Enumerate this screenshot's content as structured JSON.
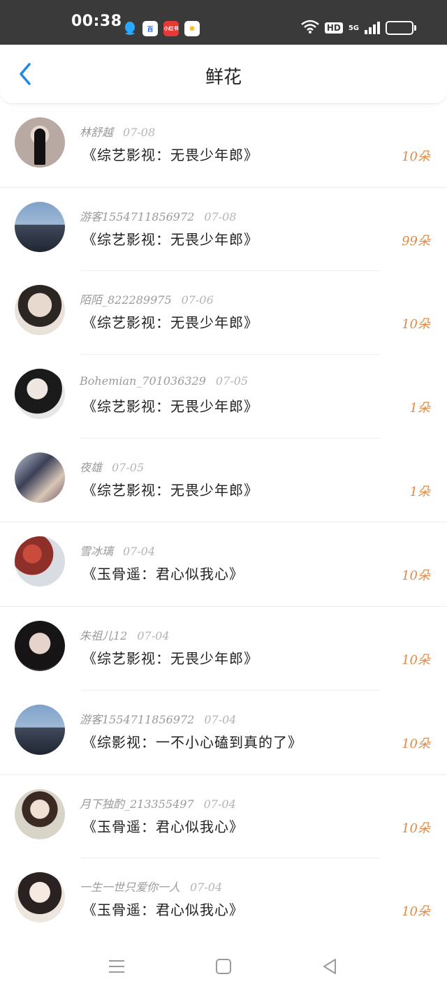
{
  "status_bar": {
    "time": "00:38",
    "apps": [
      {
        "name": "qq-app-icon"
      },
      {
        "name": "baidu-app-icon",
        "label": "百"
      },
      {
        "name": "xiaohongshu-app-icon",
        "label": "小红书"
      },
      {
        "name": "wechat-app-icon",
        "label": "●"
      }
    ],
    "hd_label": "HD",
    "network_label": "5G"
  },
  "header": {
    "title": "鲜花"
  },
  "items": [
    {
      "username": "林舒越",
      "date": "07-08",
      "work": "《综艺影视：无畏少年郎》",
      "count": "10朵"
    },
    {
      "username": "游客1554711856972",
      "date": "07-08",
      "work": "《综艺影视：无畏少年郎》",
      "count": "99朵"
    },
    {
      "username": "陌陌_822289975",
      "date": "07-06",
      "work": "《综艺影视：无畏少年郎》",
      "count": "10朵"
    },
    {
      "username": "Bohemian_701036329",
      "date": "07-05",
      "work": "《综艺影视：无畏少年郎》",
      "count": "1朵"
    },
    {
      "username": "夜雄",
      "date": "07-05",
      "work": "《综艺影视：无畏少年郎》",
      "count": "1朵"
    },
    {
      "username": "雪冰璃",
      "date": "07-04",
      "work": "《玉骨遥：君心似我心》",
      "count": "10朵"
    },
    {
      "username": "朱祖儿12",
      "date": "07-04",
      "work": "《综艺影视：无畏少年郎》",
      "count": "10朵"
    },
    {
      "username": "游客1554711856972",
      "date": "07-04",
      "work": "《综影视：一不小心磕到真的了》",
      "count": "10朵"
    },
    {
      "username": "月下独酌_213355497",
      "date": "07-04",
      "work": "《玉骨遥：君心似我心》",
      "count": "10朵"
    },
    {
      "username": "一生一世只爱你一人",
      "date": "07-04",
      "work": "《玉骨遥：君心似我心》",
      "count": "10朵"
    }
  ],
  "colors": {
    "status_bar_bg": "#3a3a3a",
    "accent_blue": "#1e88e5",
    "count_orange": "#e58a45"
  }
}
